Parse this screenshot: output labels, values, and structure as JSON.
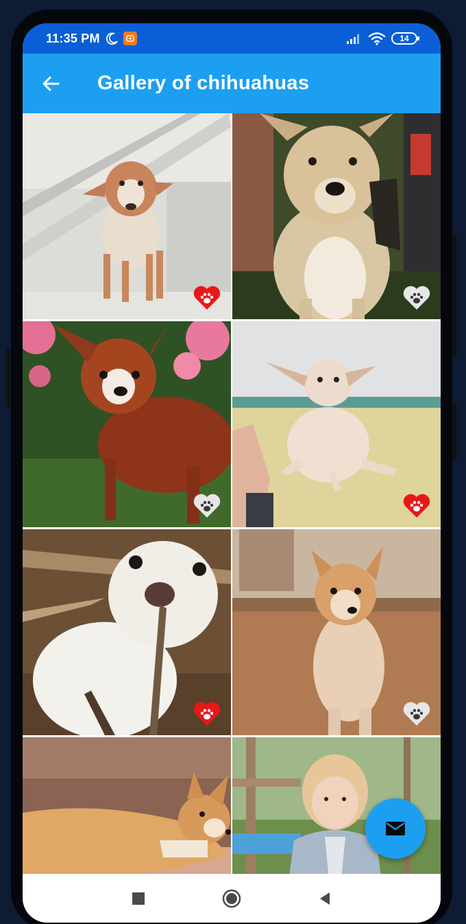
{
  "status_bar": {
    "time": "11:35 PM",
    "battery": "14",
    "icons": [
      "moon-icon",
      "app-notification-icon",
      "signal-icon",
      "wifi-icon",
      "battery-icon"
    ]
  },
  "app_bar": {
    "title": "Gallery of chihuahuas",
    "back_icon": "arrow-back-icon"
  },
  "gallery": {
    "tiles": [
      {
        "favorite": true
      },
      {
        "favorite": false
      },
      {
        "favorite": false
      },
      {
        "favorite": true
      },
      {
        "favorite": true
      },
      {
        "favorite": false
      },
      {
        "favorite": false
      },
      {
        "favorite": false
      }
    ],
    "favorite_icon": "paw-heart-icon"
  },
  "fab": {
    "icon": "mail-icon"
  },
  "nav_bar": {
    "icons": [
      "recents-square-icon",
      "home-circle-icon",
      "back-triangle-icon"
    ]
  },
  "colors": {
    "app_bar": "#1c9ff0",
    "status_bar": "#0a5fd6",
    "favorite_on": "#e81818",
    "favorite_off": "#e6e6e6"
  }
}
